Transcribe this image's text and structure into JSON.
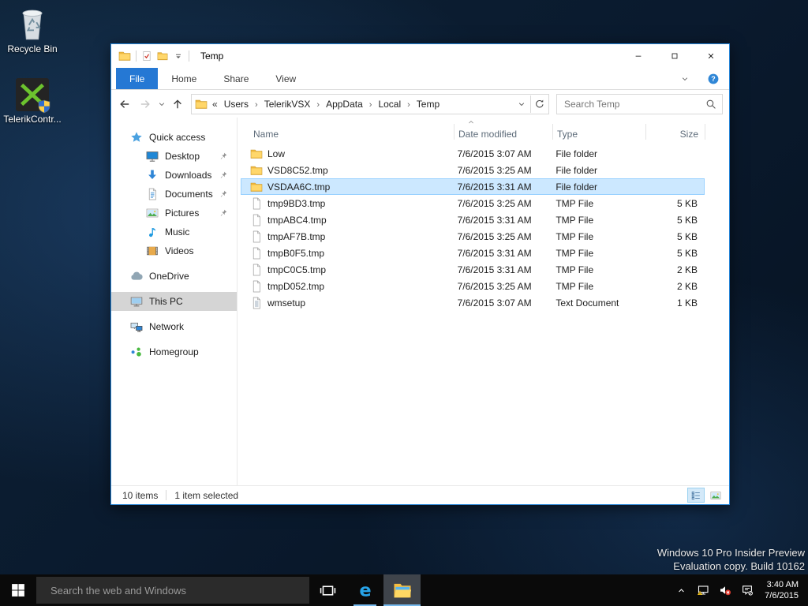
{
  "desktop": {
    "icons": [
      {
        "label": "Recycle Bin",
        "icon": "recycle"
      },
      {
        "label": "TelerikContr...",
        "icon": "telerik",
        "shield": true
      }
    ],
    "watermark_line1": "Windows 10 Pro Insider Preview",
    "watermark_line2": "Evaluation copy. Build 10162"
  },
  "window": {
    "title": "Temp",
    "qat_icons": [
      {
        "icon": "checkdoc",
        "name": "properties"
      },
      {
        "icon": "folder",
        "name": "new-folder"
      },
      {
        "icon": "qatdrop",
        "name": "customize-quick-access"
      }
    ],
    "ribbon_tabs": [
      {
        "label": "File",
        "active": true
      },
      {
        "label": "Home"
      },
      {
        "label": "Share"
      },
      {
        "label": "View"
      }
    ],
    "address": {
      "overflow": "«",
      "segments": [
        {
          "name": "Users",
          "sep": "›"
        },
        {
          "name": "TelerikVSX",
          "sep": "›"
        },
        {
          "name": "AppData",
          "sep": "›"
        },
        {
          "name": "Local",
          "sep": "›"
        },
        {
          "name": "Temp",
          "sep": ""
        }
      ]
    },
    "search_placeholder": "Search Temp",
    "sidebar": [
      {
        "label": "Quick access",
        "icon": "star",
        "level": 0
      },
      {
        "label": "Desktop",
        "icon": "desktop",
        "level": 1,
        "pinned": true
      },
      {
        "label": "Downloads",
        "icon": "download",
        "level": 1,
        "pinned": true
      },
      {
        "label": "Documents",
        "icon": "document",
        "level": 1,
        "pinned": true
      },
      {
        "label": "Pictures",
        "icon": "picture",
        "level": 1,
        "pinned": true
      },
      {
        "label": "Music",
        "icon": "music",
        "level": 1
      },
      {
        "label": "Videos",
        "icon": "film",
        "level": 1
      },
      {
        "label": "OneDrive",
        "icon": "cloud",
        "level": 0,
        "gap": true
      },
      {
        "label": "This PC",
        "icon": "pc",
        "level": 0,
        "gap": true,
        "selected": true
      },
      {
        "label": "Network",
        "icon": "network",
        "level": 0,
        "gap": true
      },
      {
        "label": "Homegroup",
        "icon": "homegroup",
        "level": 0,
        "gap": true
      }
    ],
    "columns": {
      "name": "Name",
      "date": "Date modified",
      "type": "Type",
      "size": "Size"
    },
    "files": [
      {
        "icon": "folder",
        "name": "Low",
        "date": "7/6/2015 3:07 AM",
        "type": "File folder",
        "size": ""
      },
      {
        "icon": "folder",
        "name": "VSD8C52.tmp",
        "date": "7/6/2015 3:25 AM",
        "type": "File folder",
        "size": ""
      },
      {
        "icon": "folder",
        "name": "VSDAA6C.tmp",
        "date": "7/6/2015 3:31 AM",
        "type": "File folder",
        "size": "",
        "selected": true
      },
      {
        "icon": "file",
        "name": "tmp9BD3.tmp",
        "date": "7/6/2015 3:25 AM",
        "type": "TMP File",
        "size": "5 KB"
      },
      {
        "icon": "file",
        "name": "tmpABC4.tmp",
        "date": "7/6/2015 3:31 AM",
        "type": "TMP File",
        "size": "5 KB"
      },
      {
        "icon": "file",
        "name": "tmpAF7B.tmp",
        "date": "7/6/2015 3:25 AM",
        "type": "TMP File",
        "size": "5 KB"
      },
      {
        "icon": "file",
        "name": "tmpB0F5.tmp",
        "date": "7/6/2015 3:31 AM",
        "type": "TMP File",
        "size": "5 KB"
      },
      {
        "icon": "file",
        "name": "tmpC0C5.tmp",
        "date": "7/6/2015 3:31 AM",
        "type": "TMP File",
        "size": "2 KB"
      },
      {
        "icon": "file",
        "name": "tmpD052.tmp",
        "date": "7/6/2015 3:25 AM",
        "type": "TMP File",
        "size": "2 KB"
      },
      {
        "icon": "textdoc",
        "name": "wmsetup",
        "date": "7/6/2015 3:07 AM",
        "type": "Text Document",
        "size": "1 KB"
      }
    ],
    "status_items": "10 items",
    "status_selected": "1 item selected",
    "view_buttons": [
      {
        "icon": "details",
        "name": "details-view",
        "selected": true
      },
      {
        "icon": "thumb",
        "name": "large-icons-view"
      }
    ]
  },
  "taskbar": {
    "search_placeholder": "Search the web and Windows",
    "apps": [
      {
        "icon": "taskview",
        "name": "task-view"
      },
      {
        "icon": "edge",
        "name": "microsoft-edge",
        "running": true
      },
      {
        "icon": "explorer",
        "name": "file-explorer",
        "running": true,
        "active": true
      }
    ],
    "tray": [
      {
        "icon": "traychev",
        "name": "show-hidden-icons"
      },
      {
        "icon": "netwarn",
        "name": "network-warning"
      },
      {
        "icon": "volmute",
        "name": "volume-muted"
      },
      {
        "icon": "action",
        "name": "action-center"
      }
    ],
    "clock_time": "3:40 AM",
    "clock_date": "7/6/2015"
  },
  "colors": {
    "accent": "#2578d4",
    "sel_bg": "#cce8ff",
    "sel_border": "#99d1ff",
    "side_sel": "#d5d5d5",
    "underline": "#76b9ed"
  }
}
